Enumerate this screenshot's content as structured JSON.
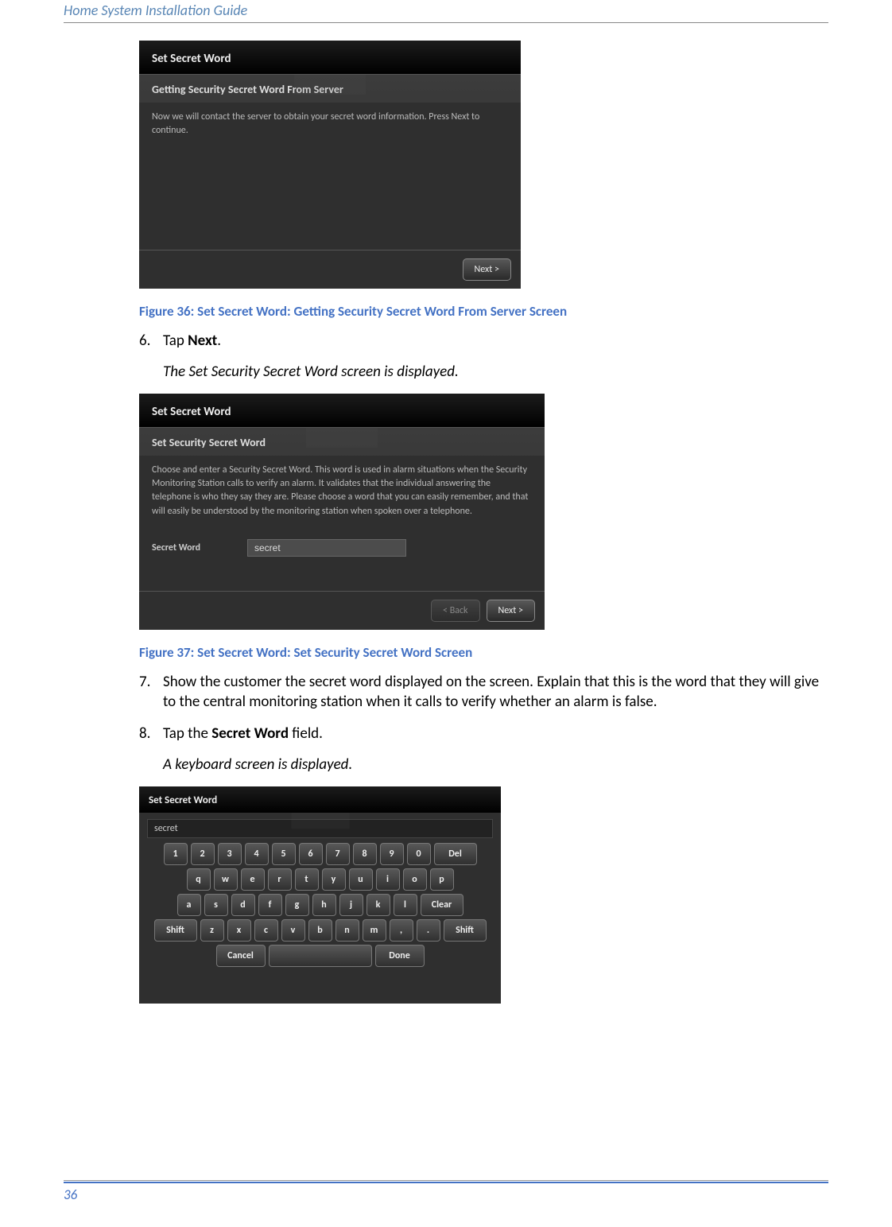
{
  "doc_header": "Home System Installation Guide",
  "page_number": "36",
  "fig1": {
    "header": "Set Secret Word",
    "sub_title": "Getting Security Secret Word From Server",
    "body": "Now we will contact the server to obtain your secret word information.  Press Next to continue.",
    "next": "Next >",
    "caption": "Figure 36:  Set Secret Word: Getting Security Secret Word From Server Screen"
  },
  "step6_num": "6.",
  "step6_pre": "Tap ",
  "step6_bold": "Next",
  "step6_post": ".",
  "step6_result": "The Set Security Secret Word screen is displayed.",
  "fig2": {
    "header": "Set Secret Word",
    "sub_title": "Set Security Secret Word",
    "body": "Choose and enter a Security Secret Word.  This word is used in alarm situations when the Security Monitoring Station calls to verify an alarm.  It validates that the individual answering the telephone is who they say they are.  Please choose a word that you can easily remember, and that will easily be understood by the monitoring station when spoken over a telephone.",
    "label": "Secret Word",
    "value": "secret",
    "back": "< Back",
    "next": "Next >",
    "caption": "Figure 37:  Set Secret Word: Set Security Secret Word Screen"
  },
  "step7_num": "7.",
  "step7_text": "Show the customer the secret word displayed on the screen. Explain that this is the word that they will give to the central monitoring station when it calls to verify whether an alarm is false.",
  "step8_num": "8.",
  "step8_pre": "Tap the ",
  "step8_bold": "Secret Word",
  "step8_post": " field.",
  "step8_result": "A keyboard screen is displayed.",
  "fig3": {
    "header": "Set Secret Word",
    "input": "secret",
    "row1": [
      "1",
      "2",
      "3",
      "4",
      "5",
      "6",
      "7",
      "8",
      "9",
      "0",
      "Del"
    ],
    "row2": [
      "q",
      "w",
      "e",
      "r",
      "t",
      "y",
      "u",
      "i",
      "o",
      "p"
    ],
    "row3": [
      "a",
      "s",
      "d",
      "f",
      "g",
      "h",
      "j",
      "k",
      "l",
      "Clear"
    ],
    "row4": [
      "Shift",
      "z",
      "x",
      "c",
      "v",
      "b",
      "n",
      "m",
      ",",
      ".",
      "Shift"
    ],
    "row5": {
      "cancel": "Cancel",
      "space": "",
      "done": "Done"
    }
  }
}
